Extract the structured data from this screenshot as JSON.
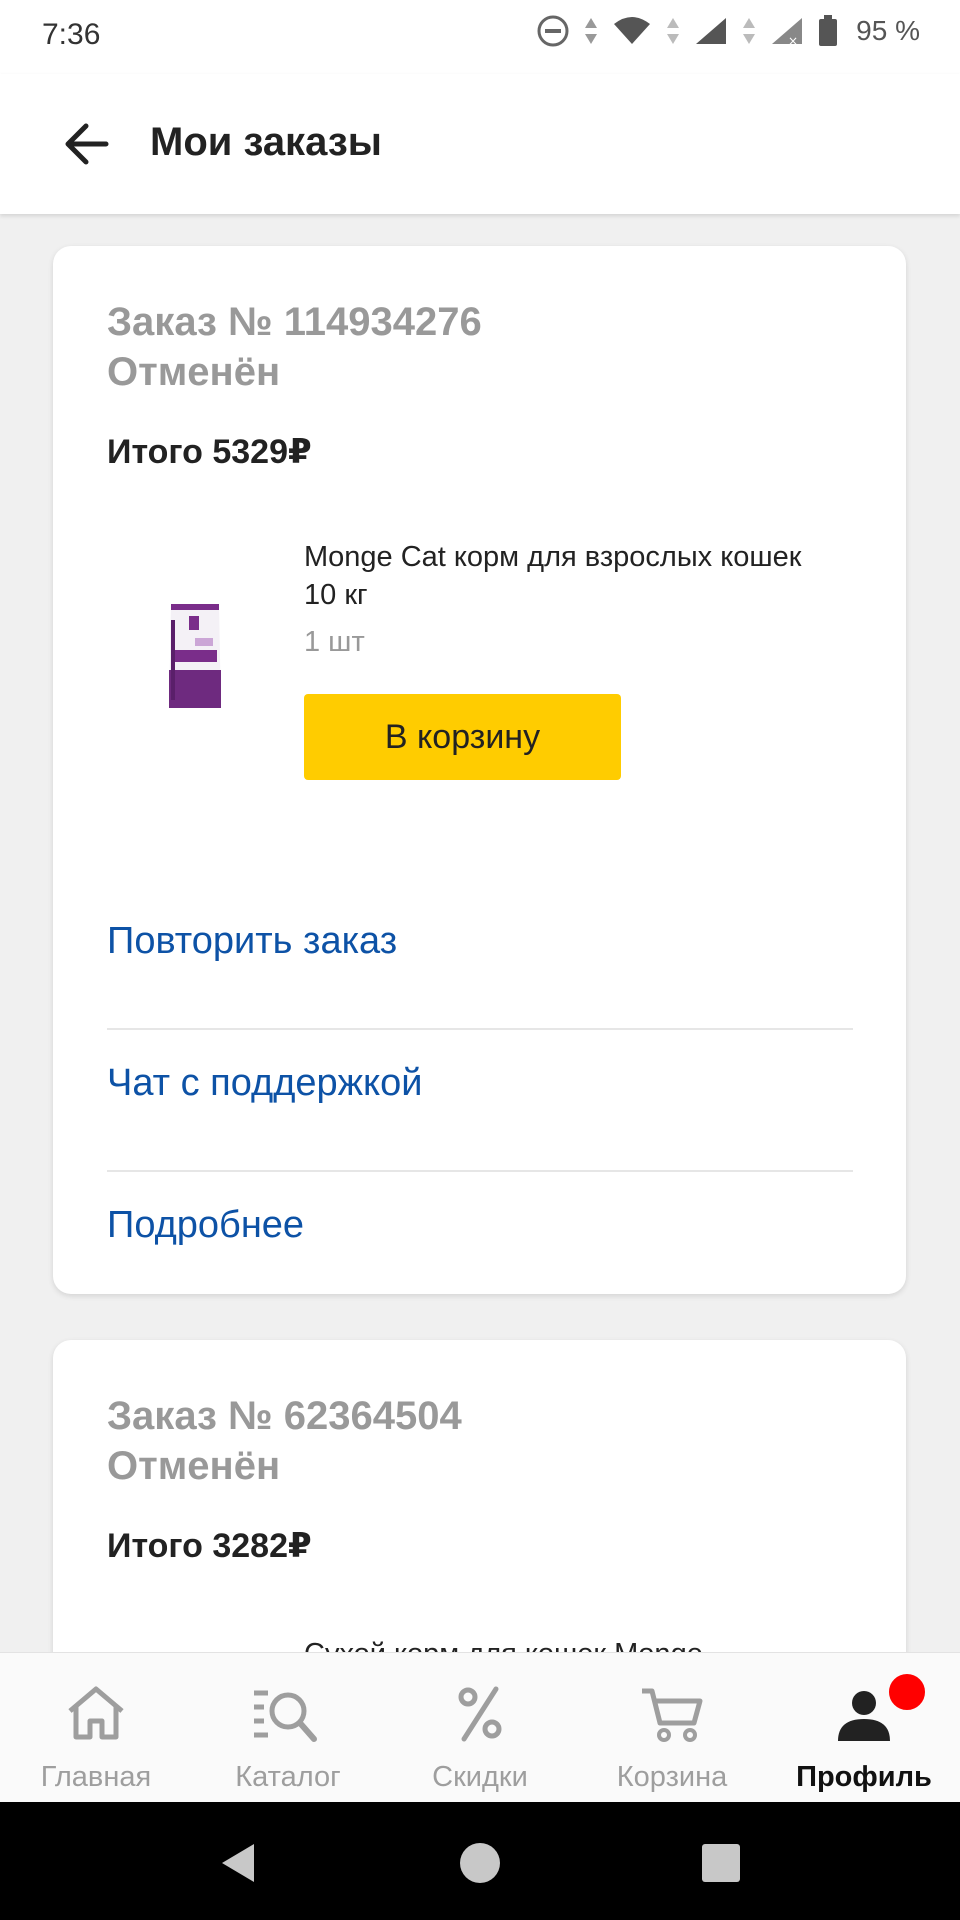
{
  "status_bar": {
    "time": "7:36",
    "battery": "95 %"
  },
  "header": {
    "title": "Мои заказы",
    "back_icon": "arrow-left-icon"
  },
  "orders": [
    {
      "number": "Заказ № 114934276",
      "status": "Отменён",
      "total": "Итого 5329₽",
      "product": {
        "name": "Monge Cat корм для взрослых кошек 10 кг",
        "qty": "1 шт",
        "button": "В корзину"
      },
      "actions": [
        "Повторить заказ",
        "Чат с поддержкой",
        "Подробнее"
      ]
    },
    {
      "number": "Заказ № 62364504",
      "status": "Отменён",
      "total": "Итого 3282₽",
      "product": {
        "name": "Сухой корм для кошек Monge"
      }
    }
  ],
  "bottom_nav": [
    {
      "label": "Главная",
      "icon": "home-icon"
    },
    {
      "label": "Каталог",
      "icon": "catalog-search-icon"
    },
    {
      "label": "Скидки",
      "icon": "percent-icon"
    },
    {
      "label": "Корзина",
      "icon": "cart-icon"
    },
    {
      "label": "Профиль",
      "icon": "profile-icon",
      "active": true,
      "has_badge": true
    }
  ],
  "colors": {
    "accent_yellow": "#ffcc00",
    "link_blue": "#0d52a6",
    "badge_red": "#ff0000"
  }
}
